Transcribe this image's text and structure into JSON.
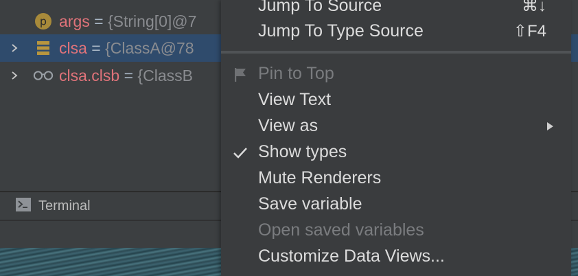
{
  "variables": [
    {
      "name": "args",
      "eq": "=",
      "value": "{String[0]@7",
      "icon": "p-badge-icon",
      "expandable": false,
      "selected": false
    },
    {
      "name": "clsa",
      "eq": "=",
      "value": "{ClassA@78",
      "icon": "field-stack-icon",
      "expandable": true,
      "selected": true
    },
    {
      "name": "clsa.clsb",
      "eq": "=",
      "value": "{ClassB",
      "icon": "watch-glasses-icon",
      "expandable": true,
      "selected": false
    }
  ],
  "terminal": {
    "label": "Terminal",
    "icon": "terminal-icon"
  },
  "menu": {
    "items": [
      {
        "label": "Jump To Source",
        "shortcut": "⌘↓",
        "enabled": true
      },
      {
        "label": "Jump To Type Source",
        "shortcut": "⇧F4",
        "enabled": true
      },
      {
        "label": "Pin to Top",
        "enabled": false,
        "icon": "flag-icon"
      },
      {
        "label": "View Text",
        "enabled": true
      },
      {
        "label": "View as",
        "enabled": true,
        "submenu": true
      },
      {
        "label": "Show types",
        "enabled": true,
        "checked": true
      },
      {
        "label": "Mute Renderers",
        "enabled": true
      },
      {
        "label": "Save variable",
        "enabled": true
      },
      {
        "label": "Open saved variables",
        "enabled": false
      },
      {
        "label": "Customize Data Views...",
        "enabled": true
      }
    ]
  },
  "colors": {
    "variable_name": "#e0737a",
    "selection": "#2f4b6c",
    "menu_background": "#3a3c3e",
    "disabled_text": "#7a7c7f"
  }
}
